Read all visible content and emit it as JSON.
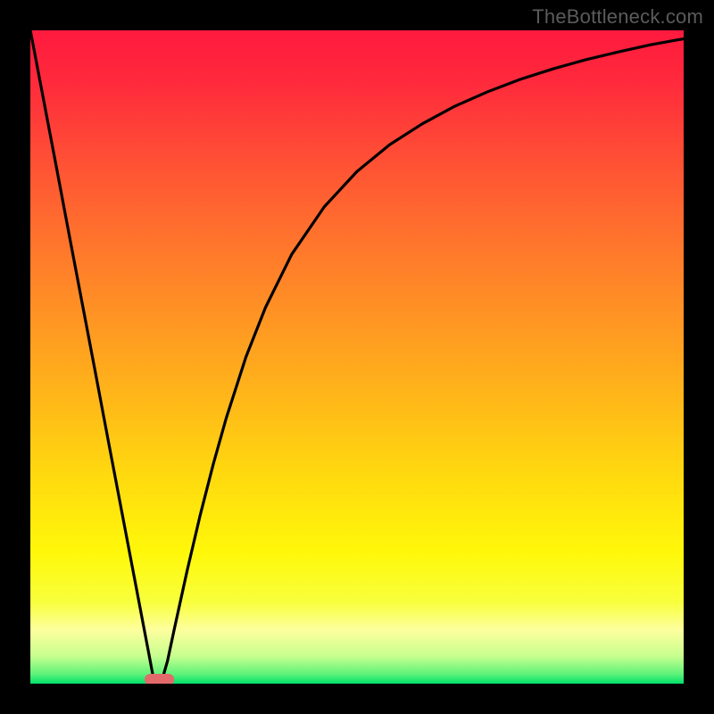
{
  "watermark": "TheBottleneck.com",
  "chart_data": {
    "type": "line",
    "title": "",
    "xlabel": "",
    "ylabel": "",
    "xlim": [
      0,
      100
    ],
    "ylim": [
      0,
      100
    ],
    "x": [
      0,
      2,
      4,
      6,
      8,
      10,
      12,
      14,
      16,
      18,
      19,
      20,
      21,
      22,
      24,
      26,
      28,
      30,
      33,
      36,
      40,
      45,
      50,
      55,
      60,
      65,
      70,
      75,
      80,
      85,
      90,
      95,
      100
    ],
    "values": [
      100,
      89.5,
      79,
      68.4,
      57.9,
      47.4,
      36.8,
      26.3,
      15.8,
      5.3,
      0,
      0,
      3.5,
      8.2,
      17.3,
      25.8,
      33.6,
      40.7,
      50,
      57.6,
      65.7,
      73,
      78.4,
      82.5,
      85.7,
      88.4,
      90.6,
      92.5,
      94.1,
      95.5,
      96.7,
      97.8,
      98.7
    ],
    "marker": {
      "x_start": 17.5,
      "x_end": 22.0,
      "y": 0
    },
    "gradient_stops": [
      {
        "offset": 0.0,
        "color": "#ff1a3e"
      },
      {
        "offset": 0.08,
        "color": "#ff2a3c"
      },
      {
        "offset": 0.18,
        "color": "#ff4a36"
      },
      {
        "offset": 0.3,
        "color": "#ff6e2e"
      },
      {
        "offset": 0.42,
        "color": "#ff8f25"
      },
      {
        "offset": 0.55,
        "color": "#ffb31a"
      },
      {
        "offset": 0.68,
        "color": "#ffd90f"
      },
      {
        "offset": 0.8,
        "color": "#fff80a"
      },
      {
        "offset": 0.875,
        "color": "#f8ff3c"
      },
      {
        "offset": 0.918,
        "color": "#fdff9e"
      },
      {
        "offset": 0.958,
        "color": "#c7ff8e"
      },
      {
        "offset": 0.985,
        "color": "#60f37a"
      },
      {
        "offset": 1.0,
        "color": "#00e06a"
      }
    ]
  }
}
